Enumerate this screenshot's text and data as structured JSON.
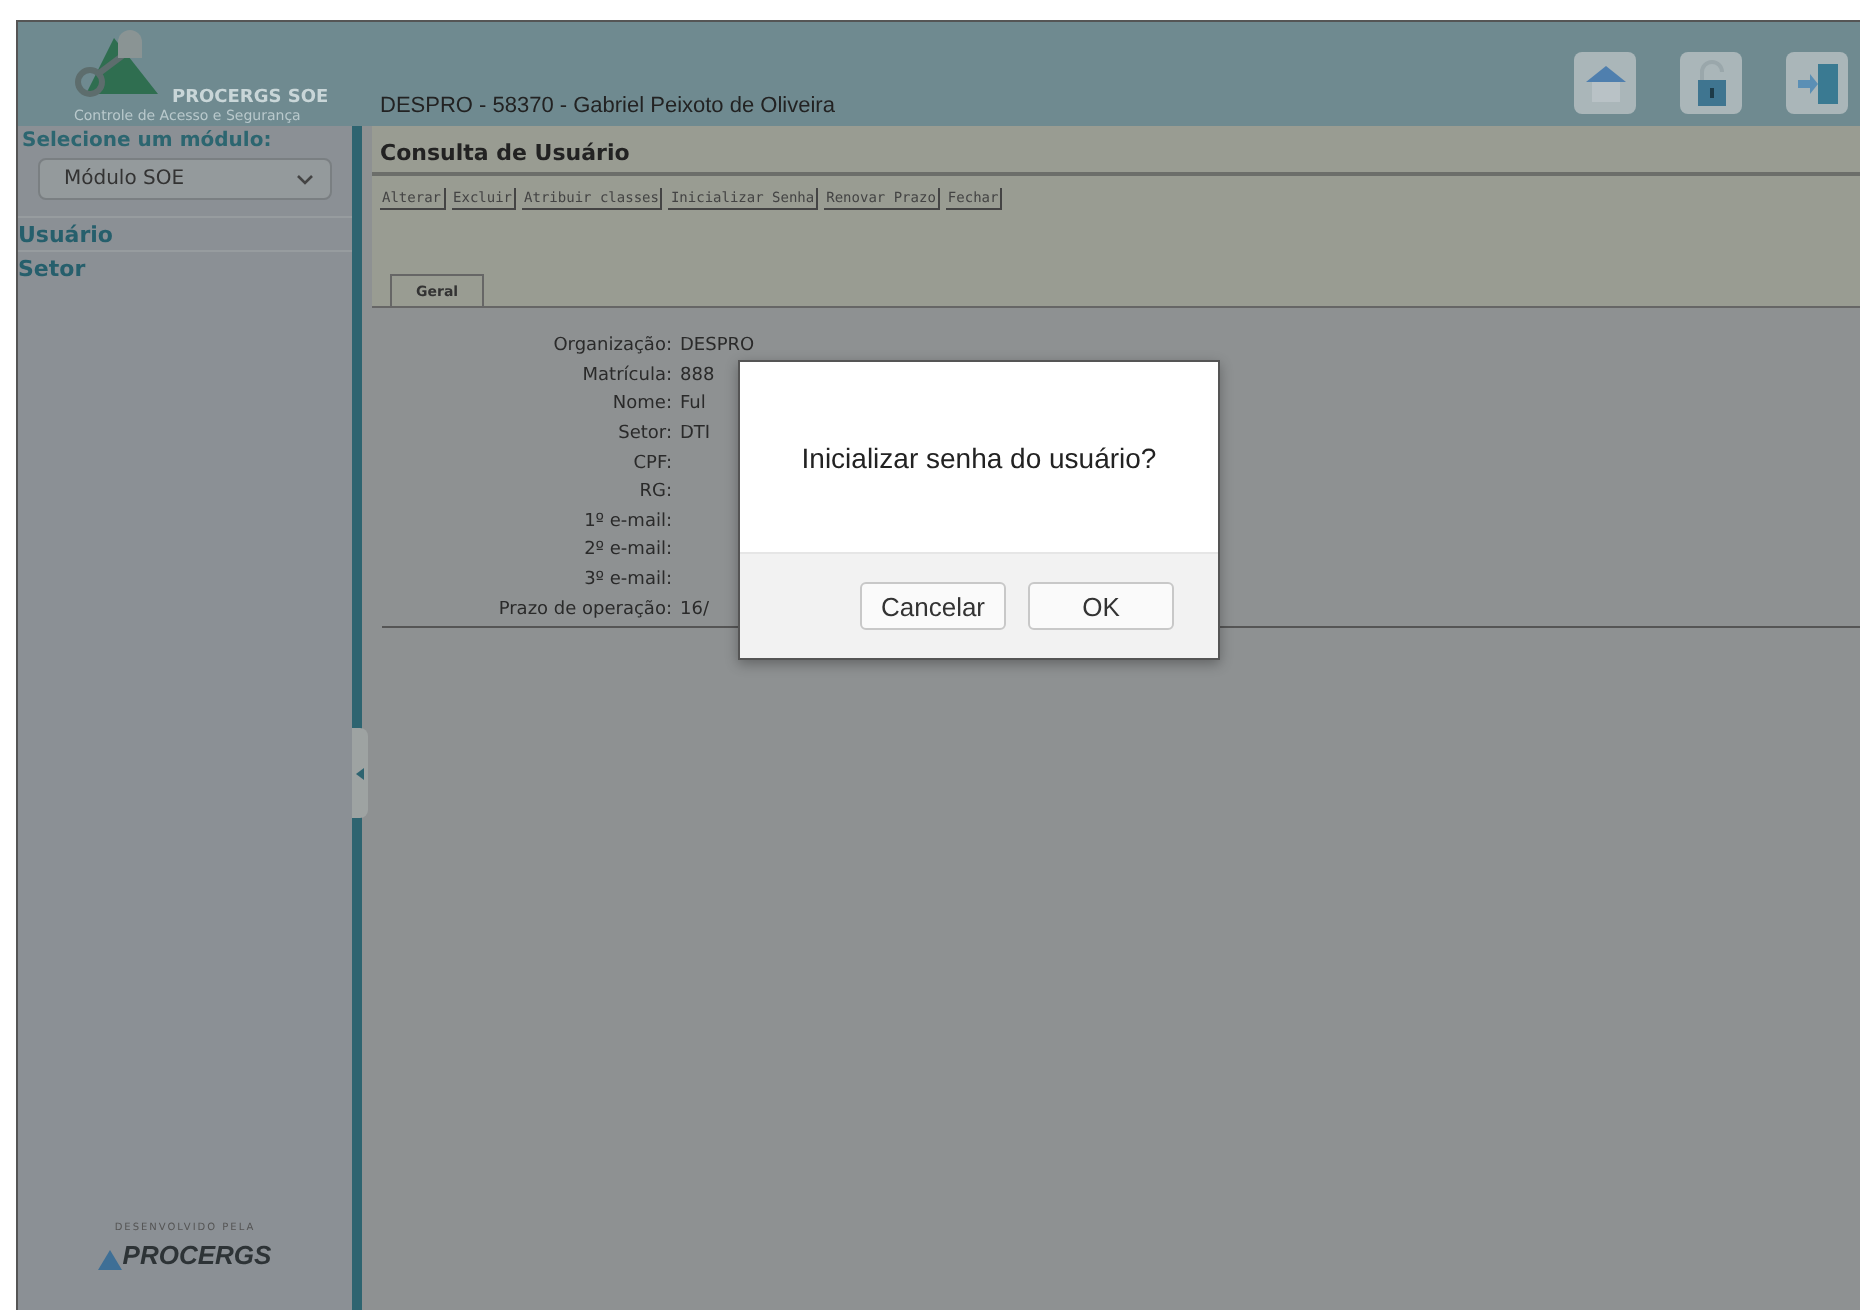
{
  "header": {
    "logo_title": "PROCERGS SOE",
    "logo_subtitle": "Controle de Acesso e Segurança",
    "user_line": "DESPRO - 58370 - Gabriel Peixoto de Oliveira"
  },
  "sidebar": {
    "module_label": "Selecione um módulo:",
    "module_value": "Módulo SOE",
    "items": [
      {
        "label": "Usuário"
      },
      {
        "label": "Setor"
      }
    ],
    "footer_caption": "DESENVOLVIDO PELA",
    "footer_brand": "PROCERGS"
  },
  "page_title": "Consulta de Usuário",
  "toolbar": [
    "Alterar",
    "Excluir",
    "Atribuir classes",
    "Inicializar Senha",
    "Renovar Prazo",
    "Fechar"
  ],
  "tabs": [
    {
      "label": "Geral",
      "selected": true
    }
  ],
  "fields": [
    {
      "label": "Organização:",
      "value": "DESPRO"
    },
    {
      "label": "Matrícula:",
      "value": "888"
    },
    {
      "label": "Nome:",
      "value": "Ful"
    },
    {
      "label": "Setor:",
      "value": "DTI"
    },
    {
      "label": "CPF:"
    },
    {
      "label": "RG:"
    },
    {
      "label": "1º e-mail:"
    },
    {
      "label": "2º e-mail:"
    },
    {
      "label": "3º e-mail:"
    },
    {
      "label": "Prazo de operação:",
      "value": "16/"
    }
  ],
  "dialog": {
    "message": "Inicializar senha do usuário?",
    "buttons": [
      "Cancelar",
      "OK"
    ]
  }
}
